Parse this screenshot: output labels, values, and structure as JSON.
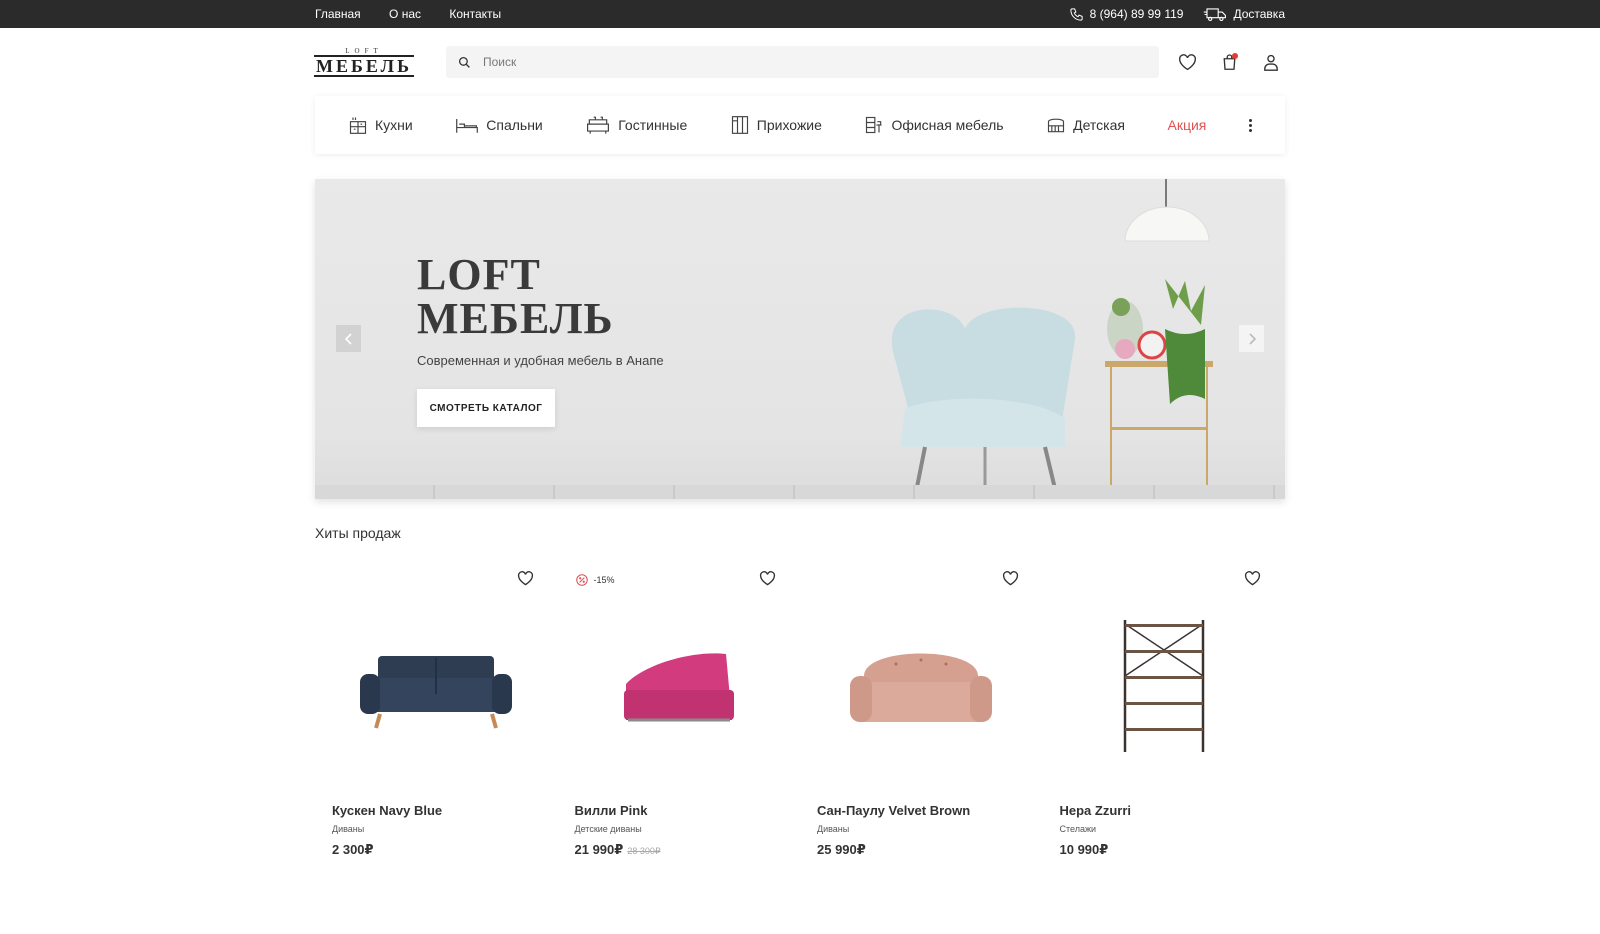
{
  "topbar": {
    "links": [
      "Главная",
      "О нас",
      "Контакты"
    ],
    "phone": "8 (964) 89 99 119",
    "delivery": "Доставка"
  },
  "header": {
    "logo_top": "LOFT",
    "logo_main": "МЕБЕЛЬ",
    "search_placeholder": "Поиск",
    "cart_dot_color": "#e53935"
  },
  "categories": [
    {
      "label": "Кухни",
      "icon": "kitchen-icon"
    },
    {
      "label": "Спальни",
      "icon": "bed-icon"
    },
    {
      "label": "Гостинные",
      "icon": "sofa-icon"
    },
    {
      "label": "Прихожие",
      "icon": "wardrobe-icon"
    },
    {
      "label": "Офисная мебель",
      "icon": "office-icon"
    },
    {
      "label": "Детская",
      "icon": "crib-icon"
    },
    {
      "label": "Акция",
      "icon": null
    }
  ],
  "hero": {
    "title_line1": "LOFT",
    "title_line2": "МЕБЕЛЬ",
    "subtitle": "Современная и удобная мебель в Анапе",
    "cta": "СМОТРЕТЬ КАТАЛОГ"
  },
  "section_title": "Хиты продаж",
  "products": [
    {
      "name": "Кускен Navy Blue",
      "category": "Диваны",
      "price": "2 300₽",
      "old_price": "",
      "badge": "",
      "color": "#2f3d52"
    },
    {
      "name": "Вилли Pink",
      "category": "Детские диваны",
      "price": "21 990₽",
      "old_price": "28 300₽",
      "badge": "-15%",
      "color": "#d23c7f"
    },
    {
      "name": "Сан-Паулу Velvet Brown",
      "category": "Диваны",
      "price": "25 990₽",
      "old_price": "",
      "badge": "",
      "color": "#d8a494"
    },
    {
      "name": "Нера Zzurri",
      "category": "Стелажи",
      "price": "10 990₽",
      "old_price": "",
      "badge": "",
      "color": "#3a3431"
    }
  ],
  "colors": {
    "topbar_bg": "#2b2b2b",
    "sale": "#e05353",
    "badge": "#e05353"
  }
}
